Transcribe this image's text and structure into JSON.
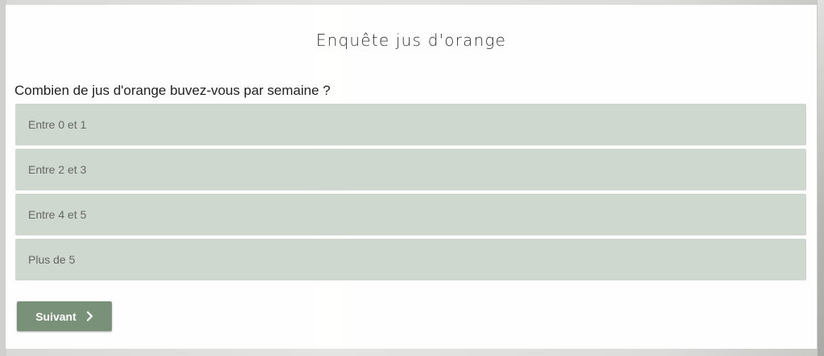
{
  "survey": {
    "title": "Enquête jus d'orange",
    "question": "Combien de jus d'orange buvez-vous par semaine ?",
    "options": [
      {
        "label": "Entre 0 et 1"
      },
      {
        "label": "Entre 2 et 3"
      },
      {
        "label": "Entre 4 et 5"
      },
      {
        "label": "Plus de 5"
      }
    ],
    "next_label": "Suivant",
    "next_icon": "chevron-right-icon"
  },
  "colors": {
    "option_bg": "#cfd8cf",
    "button_bg": "#7a9179"
  }
}
